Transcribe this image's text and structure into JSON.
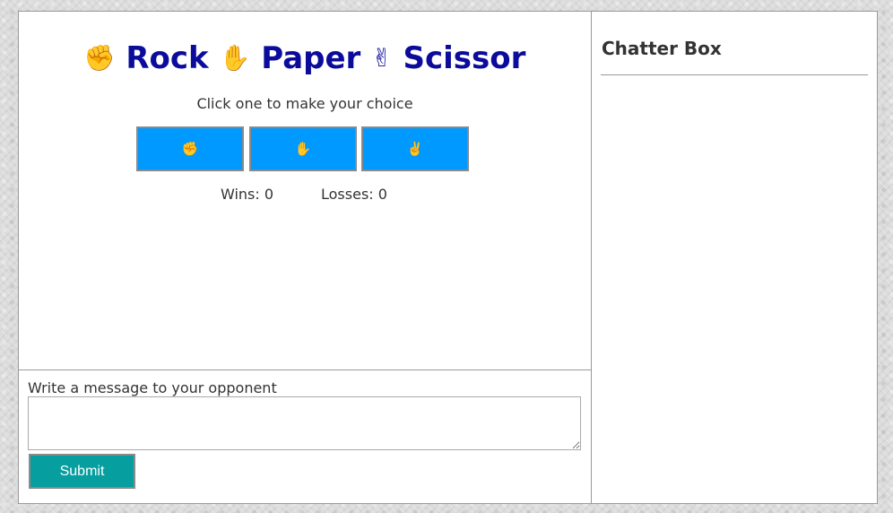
{
  "game": {
    "title": {
      "rock_icon": "✊",
      "rock_label": "Rock",
      "paper_icon": "✋",
      "paper_label": "Paper",
      "scissor_icon": "✌",
      "scissor_label": "Scissor"
    },
    "instruction": "Click one to make your choice",
    "choices": [
      {
        "icon_name": "rock-hand-icon",
        "glyph": "✊"
      },
      {
        "icon_name": "paper-hand-icon",
        "glyph": "✋"
      },
      {
        "icon_name": "scissor-hand-icon",
        "glyph": "✌"
      }
    ],
    "score": {
      "wins_text": "Wins: 0",
      "losses_text": "Losses: 0"
    }
  },
  "message": {
    "label": "Write a message to your opponent",
    "value": "",
    "submit_label": "Submit"
  },
  "chat": {
    "title": "Chatter Box",
    "messages": []
  },
  "colors": {
    "title": "#0b0b9c",
    "choice_button": "#0099ff",
    "submit_button": "#069e9e",
    "panel_background": "#ffffff",
    "page_background": "#dcdcdc"
  }
}
